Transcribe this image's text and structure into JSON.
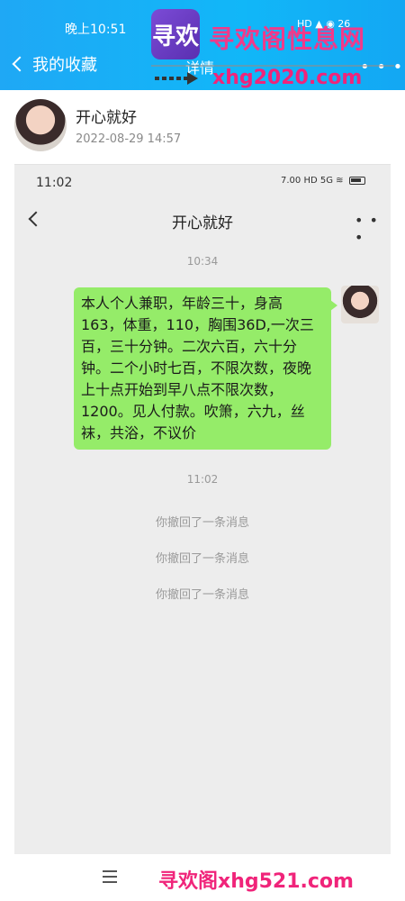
{
  "status": {
    "time": "晚上10:51",
    "icons": "HD ▲ ◉ 26"
  },
  "header": {
    "back_label": "我的收藏",
    "title": "详情",
    "more": "• • •"
  },
  "watermark": {
    "logo": "寻欢",
    "site_name": "寻欢阁性息网",
    "site_url": "xhg2020.com",
    "bottom_text": "寻欢阁xhg521.com"
  },
  "author": {
    "name": "开心就好",
    "date": "2022-08-29 14:57"
  },
  "shot": {
    "status_time": "11:02",
    "status_icons": "7.00 HD 5G ≋",
    "title": "开心就好",
    "more": "• • •",
    "time1": "10:34",
    "message": "本人个人兼职，年龄三十，身高163，体重，110，胸围36D,一次三百，三十分钟。二次六百，六十分钟。二个小时七百，不限次数，夜晚上十点开始到早八点不限次数，1200。见人付款。吹箫，六九，丝袜，共浴，不议价",
    "time2": "11:02",
    "recalls": [
      "你撤回了一条消息",
      "你撤回了一条消息",
      "你撤回了一条消息"
    ]
  }
}
